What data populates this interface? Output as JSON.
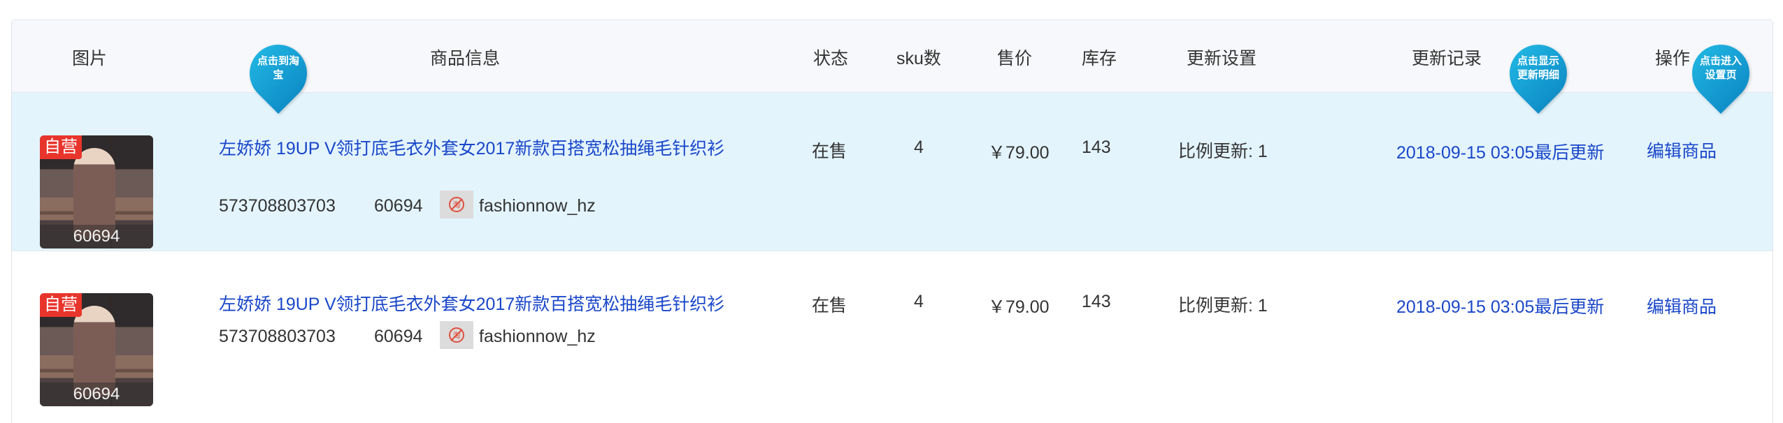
{
  "header": {
    "col_image": "图片",
    "col_info": "商品信息",
    "col_status": "状态",
    "col_sku": "sku数",
    "col_price": "售价",
    "col_stock": "库存",
    "col_update_settings": "更新设置",
    "col_update_log": "更新记录",
    "col_actions": "操作"
  },
  "tooltips": {
    "taobao": [
      "点击到淘",
      "宝"
    ],
    "detail": [
      "点击显示",
      "更新明细"
    ],
    "settings": [
      "点击进入",
      "设置页"
    ]
  },
  "colors": {
    "header_bg": "#f6f8fb",
    "row_highlight_bg": "#e3f4fd",
    "link": "#1a47c9",
    "tag_red": "#e8352c",
    "tooltip_blue": "#1fb3e0"
  },
  "rows": [
    {
      "tag": "自营",
      "image_code": "60694",
      "title": "左娇娇 19UP V领打底毛衣外套女2017新款百搭宽松抽绳毛针织衫",
      "item_id": "573708803703",
      "code": "60694",
      "shop_icon": "taobao-shop-icon",
      "shop": "fashionnow_hz",
      "status": "在售",
      "sku": "4",
      "price": "￥79.00",
      "stock": "143",
      "update_setting": "比例更新: 1",
      "update_log": "2018-09-15 03:05最后更新",
      "action": "编辑商品"
    },
    {
      "tag": "自营",
      "image_code": "60694",
      "title": "左娇娇 19UP V领打底毛衣外套女2017新款百搭宽松抽绳毛针织衫",
      "item_id": "573708803703",
      "code": "60694",
      "shop_icon": "taobao-shop-icon",
      "shop": "fashionnow_hz",
      "status": "在售",
      "sku": "4",
      "price": "￥79.00",
      "stock": "143",
      "update_setting": "比例更新: 1",
      "update_log": "2018-09-15 03:05最后更新",
      "action": "编辑商品"
    }
  ]
}
